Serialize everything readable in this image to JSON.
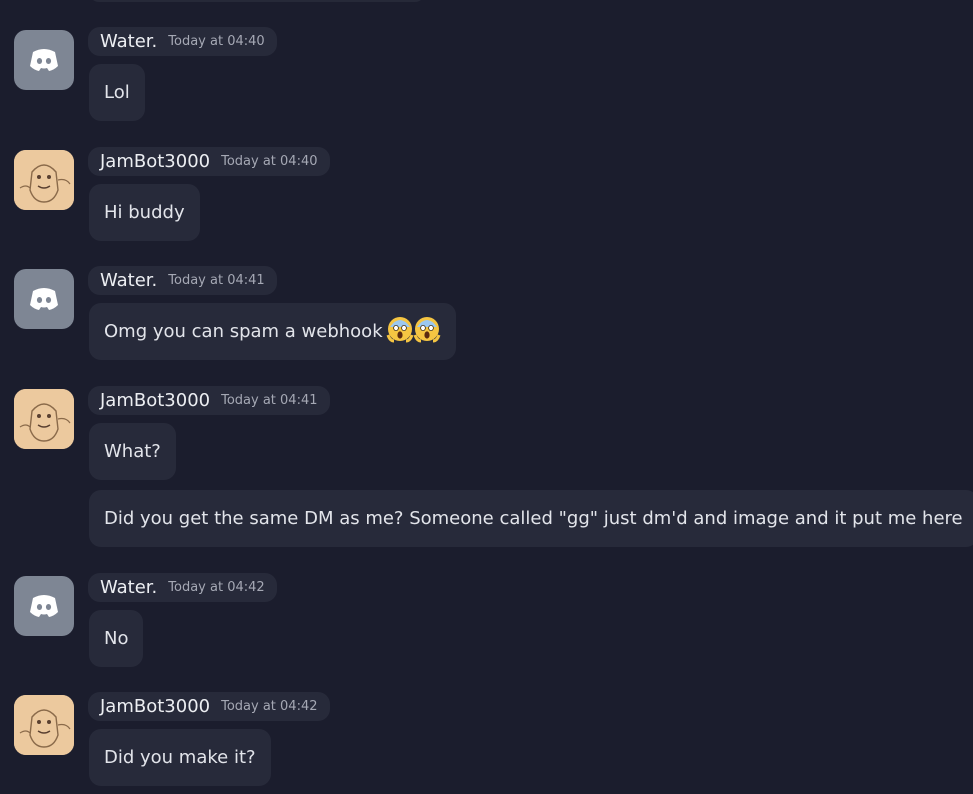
{
  "messages": [
    {
      "author": "Water.",
      "avatar": "discord-logo-icon",
      "timestamp": "Today at 04:40",
      "lines": [
        "Lol"
      ]
    },
    {
      "author": "JamBot3000",
      "avatar": "cartoon-character-avatar",
      "timestamp": "Today at 04:40",
      "lines": [
        "Hi buddy"
      ]
    },
    {
      "author": "Water.",
      "avatar": "discord-logo-icon",
      "timestamp": "Today at 04:41",
      "lines": [
        "Omg you can spam a webhook"
      ],
      "emoji": "screaming-face-emoji x2"
    },
    {
      "author": "JamBot3000",
      "avatar": "cartoon-character-avatar",
      "timestamp": "Today at 04:41",
      "lines": [
        "What?",
        "Did you get the same DM as me? Someone called \"gg\" just dm'd and image and it put me here"
      ]
    },
    {
      "author": "Water.",
      "avatar": "discord-logo-icon",
      "timestamp": "Today at 04:42",
      "lines": [
        "No"
      ]
    },
    {
      "author": "JamBot3000",
      "avatar": "cartoon-character-avatar",
      "timestamp": "Today at 04:42",
      "lines": [
        "Did you make it?"
      ]
    }
  ],
  "colors": {
    "background": "#1b1d2d",
    "bubble": "#272a3a",
    "discord_avatar": "#7e8694",
    "jam_avatar": "#ecc99e"
  }
}
